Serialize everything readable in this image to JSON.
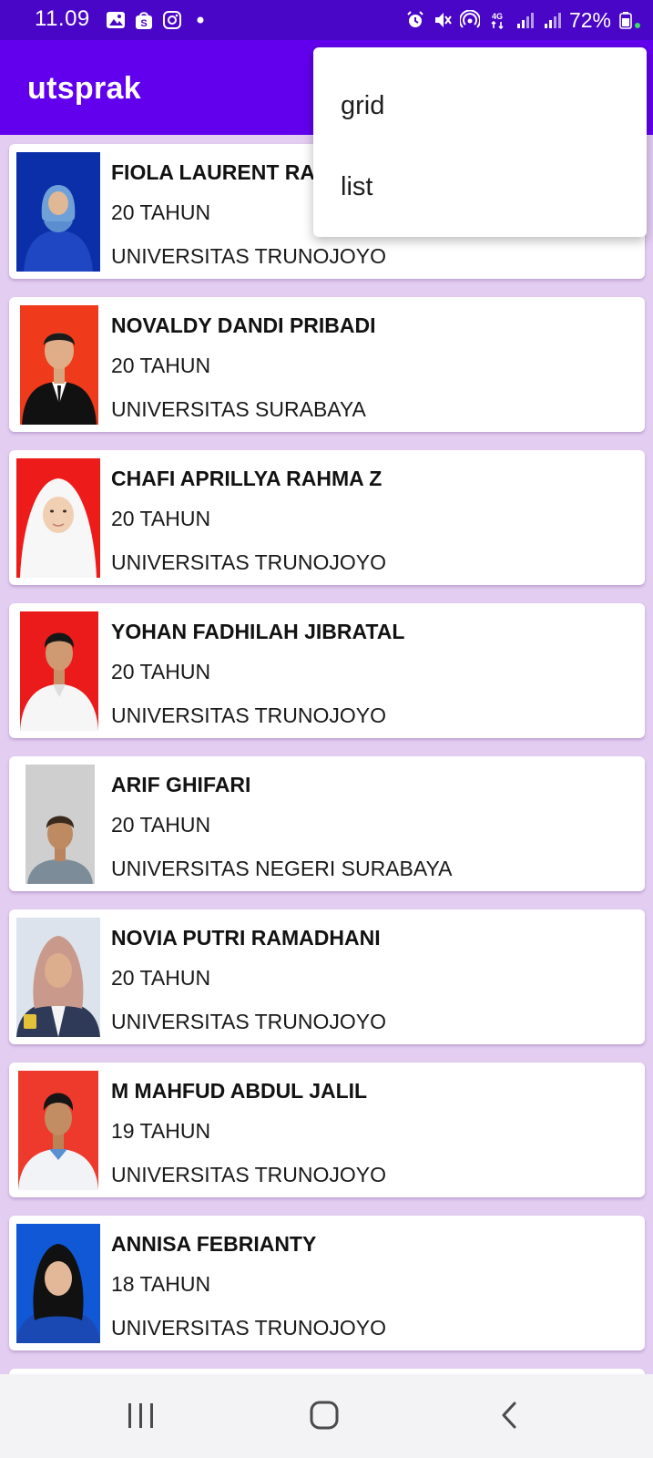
{
  "status_bar": {
    "time": "11.09",
    "battery": "72%",
    "left_icons": [
      "gallery-icon",
      "shopee-icon",
      "instagram-icon",
      "dot-icon"
    ],
    "right_icons": [
      "alarm-icon",
      "mute-icon",
      "hotspot-icon",
      "4g-icon",
      "signal-icon",
      "signal-icon",
      "battery-icon"
    ]
  },
  "app_bar": {
    "title": "utsprak"
  },
  "menu": {
    "items": [
      "grid",
      "list"
    ]
  },
  "students": [
    {
      "name": "FIOLA LAURENT RA",
      "age": "20 TAHUN",
      "university": "UNIVERSITAS TRUNOJOYO",
      "photo_bg": "#0a2fa8",
      "outfit": "#1f47c4",
      "hijab": "#6fa0d8"
    },
    {
      "name": "NOVALDY DANDI PRIBADI",
      "age": "20 TAHUN",
      "university": "UNIVERSITAS SURABAYA",
      "photo_bg": "#ef3a1c",
      "outfit": "#111111",
      "hijab": ""
    },
    {
      "name": "CHAFI APRILLYA RAHMA Z",
      "age": "20 TAHUN",
      "university": "UNIVERSITAS TRUNOJOYO",
      "photo_bg": "#ee1b1b",
      "outfit": "#f4f4f4",
      "hijab": "#f7f7f7"
    },
    {
      "name": "YOHAN FADHILAH JIBRATAL",
      "age": "20 TAHUN",
      "university": "UNIVERSITAS TRUNOJOYO",
      "photo_bg": "#ec1b1b",
      "outfit": "#f6f6f6",
      "hijab": ""
    },
    {
      "name": "ARIF GHIFARI",
      "age": "20 TAHUN",
      "university": "UNIVERSITAS NEGERI SURABAYA",
      "photo_bg": "#cfcfcf",
      "outfit": "#7c8d99",
      "hijab": ""
    },
    {
      "name": "NOVIA PUTRI RAMADHANI",
      "age": "20 TAHUN",
      "university": "UNIVERSITAS TRUNOJOYO",
      "photo_bg": "#dde3ec",
      "outfit": "#2e3a58",
      "hijab": "#c99a8c"
    },
    {
      "name": "M MAHFUD ABDUL JALIL",
      "age": "19 TAHUN",
      "university": "UNIVERSITAS TRUNOJOYO",
      "photo_bg": "#ee3a2c",
      "outfit": "#f1f3f6",
      "hijab": ""
    },
    {
      "name": "ANNISA FEBRIANTY",
      "age": "18 TAHUN",
      "university": "UNIVERSITAS TRUNOJOYO",
      "photo_bg": "#1058d6",
      "outfit": "#1a49b4",
      "hijab": "#111111"
    }
  ],
  "nav_bar": {
    "buttons": [
      "recents-icon",
      "home-icon",
      "back-icon"
    ]
  }
}
